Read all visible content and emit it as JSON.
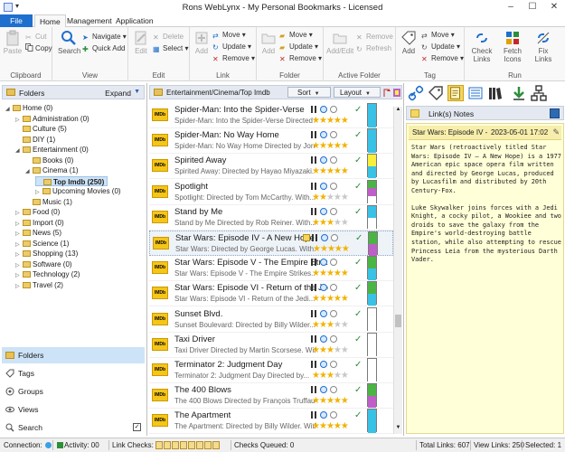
{
  "window": {
    "title": "Rons WebLynx - My Personal Bookmarks - Licensed",
    "minimize": "–",
    "maximize": "☐",
    "close": "✕"
  },
  "tabs": {
    "file": "File",
    "home": "Home",
    "management": "Management",
    "application": "Application"
  },
  "ribbon": {
    "clipboard": {
      "label": "Clipboard",
      "paste": "Paste",
      "cut": "Cut",
      "copy": "Copy"
    },
    "view": {
      "label": "View",
      "search": "Search",
      "navigate": "Navigate",
      "quick_add": "Quick Add"
    },
    "edit": {
      "label": "Edit",
      "edit": "Edit",
      "delete": "Delete",
      "select": "Select"
    },
    "link": {
      "label": "Link",
      "add": "Add",
      "move": "Move",
      "update": "Update",
      "remove": "Remove"
    },
    "folder": {
      "label": "Folder",
      "add": "Add",
      "move": "Move",
      "update": "Update",
      "remove": "Remove"
    },
    "active_folder": {
      "label": "Active Folder",
      "add_edit": "Add/Edit",
      "remove": "Remove",
      "refresh": "Refresh"
    },
    "tag": {
      "label": "Tag",
      "add": "Add",
      "move": "Move",
      "update": "Update",
      "remove": "Remove"
    },
    "run": {
      "label": "Run",
      "check_links": "Check Links",
      "fetch_icons": "Fetch Icons",
      "fix_links": "Fix Links"
    }
  },
  "folders_pane": {
    "header": "Folders",
    "expand": "Expand",
    "tree": [
      {
        "label": "Home (0)",
        "level": 0,
        "twisty": "◢"
      },
      {
        "label": "Administration (0)",
        "level": 1,
        "twisty": "▷"
      },
      {
        "label": "Culture (5)",
        "level": 1,
        "twisty": ""
      },
      {
        "label": "DIY (1)",
        "level": 1,
        "twisty": ""
      },
      {
        "label": "Entertainment (0)",
        "level": 1,
        "twisty": "◢"
      },
      {
        "label": "Books (0)",
        "level": 2,
        "twisty": ""
      },
      {
        "label": "Cinema (1)",
        "level": 2,
        "twisty": "◢"
      },
      {
        "label": "Top Imdb (250)",
        "level": 3,
        "twisty": "",
        "selected": true
      },
      {
        "label": "Upcoming Movies (0)",
        "level": 3,
        "twisty": "▷"
      },
      {
        "label": "Music (1)",
        "level": 2,
        "twisty": ""
      },
      {
        "label": "Food (0)",
        "level": 1,
        "twisty": "▷"
      },
      {
        "label": "Import (0)",
        "level": 1,
        "twisty": "▷"
      },
      {
        "label": "News (5)",
        "level": 1,
        "twisty": "▷"
      },
      {
        "label": "Science (1)",
        "level": 1,
        "twisty": "▷"
      },
      {
        "label": "Shopping (13)",
        "level": 1,
        "twisty": "▷"
      },
      {
        "label": "Software (0)",
        "level": 1,
        "twisty": "▷"
      },
      {
        "label": "Technology (2)",
        "level": 1,
        "twisty": "▷"
      },
      {
        "label": "Travel (2)",
        "level": 1,
        "twisty": "▷"
      }
    ],
    "views": {
      "folders": "Folders",
      "tags": "Tags",
      "groups": "Groups",
      "views": "Views",
      "search": "Search"
    }
  },
  "bookmarks_pane": {
    "path": "Entertainment/Cinema/Top Imdb",
    "sort": "Sort",
    "layout": "Layout",
    "items": [
      {
        "title": "Spider-Man: Into the Spider-Verse",
        "desc": "Spider-Man: Into the Spider-Verse Directed by Bob Persichetti...",
        "stars": 5,
        "colors": [
          "#39c1e6"
        ]
      },
      {
        "title": "Spider-Man: No Way Home",
        "desc": "Spider-Man: No Way Home Directed by Jon Watts. With...",
        "stars": 5,
        "colors": [
          "#39c1e6"
        ]
      },
      {
        "title": "Spirited Away",
        "desc": "Spirited Away: Directed by Hayao Miyazaki. With...",
        "stars": 5,
        "colors": [
          "#f7ef3a",
          "#39c1e6"
        ]
      },
      {
        "title": "Spotlight",
        "desc": "Spotlight: Directed by Tom McCarthy. With...",
        "stars": 2,
        "colors": [
          "#4bb543",
          "#c05ec9",
          "#ffffff"
        ]
      },
      {
        "title": "Stand by Me",
        "desc": "Stand by Me Directed by Rob Reiner. With...",
        "stars": 3,
        "colors": [
          "#39c1e6",
          "#ffffff"
        ]
      },
      {
        "title": "Star Wars: Episode IV - A New Hope",
        "desc": "Star Wars: Directed by George Lucas. With...",
        "stars": 5,
        "colors": [
          "#4bb543",
          "#c05ec9"
        ],
        "selected": true
      },
      {
        "title": "Star Wars: Episode V - The Empire Strikes Back",
        "desc": "Star Wars: Episode V - The Empire Strikes...",
        "stars": 5,
        "colors": [
          "#4bb543",
          "#39c1e6"
        ]
      },
      {
        "title": "Star Wars: Episode VI - Return of the Jedi",
        "desc": "Star Wars: Episode VI - Return of the Jedi...",
        "stars": 5,
        "colors": [
          "#4bb543",
          "#39c1e6"
        ]
      },
      {
        "title": "Sunset Blvd.",
        "desc": "Sunset Boulevard: Directed by Billy Wilder...",
        "stars": 3,
        "colors": [
          "#ffffff"
        ]
      },
      {
        "title": "Taxi Driver",
        "desc": "Taxi Driver Directed by Martin Scorsese. With...",
        "stars": 3,
        "colors": [
          "#ffffff"
        ]
      },
      {
        "title": "Terminator 2: Judgment Day",
        "desc": "Terminator 2: Judgment Day Directed by...",
        "stars": 3,
        "colors": [
          "#ffffff"
        ]
      },
      {
        "title": "The 400 Blows",
        "desc": "The 400 Blows Directed by François Truffaut...",
        "stars": 5,
        "colors": [
          "#4bb543",
          "#c05ec9"
        ]
      },
      {
        "title": "The Apartment",
        "desc": "The Apartment: Directed by Billy Wilder. With...",
        "stars": 5,
        "colors": [
          "#39c1e6"
        ]
      }
    ]
  },
  "notes_pane": {
    "header": "Link(s) Notes",
    "note_title": "Star Wars: Episode IV - A New Hope",
    "note_date": "2023-05-01 17:02",
    "paragraphs": [
      "Star Wars (retroactively titled Star Wars: Episode IV – A New Hope) is a 1977 American epic space opera film written and directed by George Lucas, produced by Lucasfilm and distributed by 20th Century-Fox.",
      "Luke Skywalker joins forces with a Jedi Knight, a cocky pilot, a Wookiee and two droids to save the galaxy from the Empire's world-destroying battle station, while also attempting to rescue Princess Leia from the mysterious Darth Vader."
    ]
  },
  "statusbar": {
    "connection": "Connection:",
    "activity": "Activity: 00",
    "link_checks": "Link Checks:",
    "checks_queued": "Checks Queued: 0",
    "total_links": "Total Links: 607",
    "view_links": "View Links: 250",
    "selected": "Selected: 1"
  }
}
